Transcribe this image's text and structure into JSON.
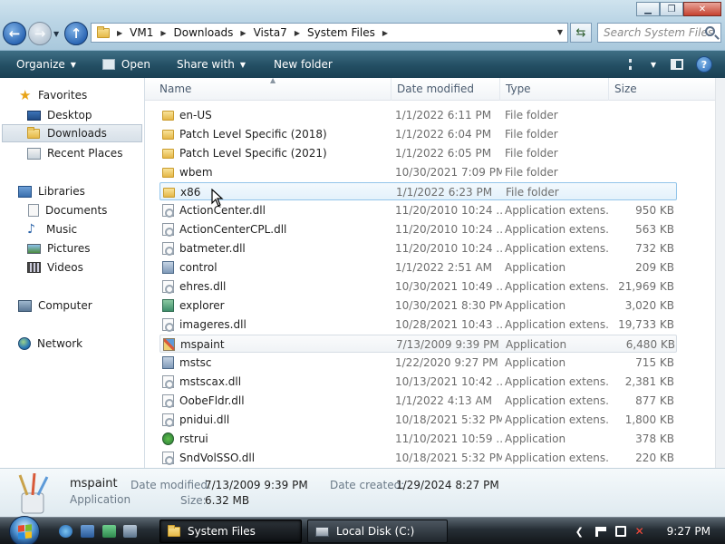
{
  "window": {
    "address": [
      "VM1",
      "Downloads",
      "Vista7",
      "System Files"
    ],
    "search_placeholder": "Search System Files"
  },
  "toolbar": {
    "organize": "Organize",
    "open": "Open",
    "share_with": "Share with",
    "new_folder": "New folder"
  },
  "sidebar": {
    "favorites": "Favorites",
    "desktop": "Desktop",
    "downloads": "Downloads",
    "recent": "Recent Places",
    "libraries": "Libraries",
    "documents": "Documents",
    "music": "Music",
    "pictures": "Pictures",
    "videos": "Videos",
    "computer": "Computer",
    "network": "Network"
  },
  "columns": {
    "name": "Name",
    "date": "Date modified",
    "type": "Type",
    "size": "Size"
  },
  "files": [
    {
      "name": "en-US",
      "date": "1/1/2022 6:11 PM",
      "type": "File folder",
      "size": "",
      "icon": "folder"
    },
    {
      "name": "Patch Level Specific (2018)",
      "date": "1/1/2022 6:04 PM",
      "type": "File folder",
      "size": "",
      "icon": "folder"
    },
    {
      "name": "Patch Level Specific (2021)",
      "date": "1/1/2022 6:05 PM",
      "type": "File folder",
      "size": "",
      "icon": "folder"
    },
    {
      "name": "wbem",
      "date": "10/30/2021 7:09 PM",
      "type": "File folder",
      "size": "",
      "icon": "folder"
    },
    {
      "name": "x86",
      "date": "1/1/2022 6:23 PM",
      "type": "File folder",
      "size": "",
      "icon": "folder"
    },
    {
      "name": "ActionCenter.dll",
      "date": "11/20/2010 10:24 ...",
      "type": "Application extens...",
      "size": "950 KB",
      "icon": "dll"
    },
    {
      "name": "ActionCenterCPL.dll",
      "date": "11/20/2010 10:24 ...",
      "type": "Application extens...",
      "size": "563 KB",
      "icon": "dll"
    },
    {
      "name": "batmeter.dll",
      "date": "11/20/2010 10:24 ...",
      "type": "Application extens...",
      "size": "732 KB",
      "icon": "dll"
    },
    {
      "name": "control",
      "date": "1/1/2022 2:51 AM",
      "type": "Application",
      "size": "209 KB",
      "icon": "app"
    },
    {
      "name": "ehres.dll",
      "date": "10/30/2021 10:49 ...",
      "type": "Application extens...",
      "size": "21,969 KB",
      "icon": "dll"
    },
    {
      "name": "explorer",
      "date": "10/30/2021 8:30 PM",
      "type": "Application",
      "size": "3,020 KB",
      "icon": "app-green"
    },
    {
      "name": "imageres.dll",
      "date": "10/28/2021 10:43 ...",
      "type": "Application extens...",
      "size": "19,733 KB",
      "icon": "dll"
    },
    {
      "name": "mspaint",
      "date": "7/13/2009 9:39 PM",
      "type": "Application",
      "size": "6,480 KB",
      "icon": "paint"
    },
    {
      "name": "mstsc",
      "date": "1/22/2020 9:27 PM",
      "type": "Application",
      "size": "715 KB",
      "icon": "app"
    },
    {
      "name": "mstscax.dll",
      "date": "10/13/2021 10:42 ...",
      "type": "Application extens...",
      "size": "2,381 KB",
      "icon": "dll"
    },
    {
      "name": "OobeFldr.dll",
      "date": "1/1/2022 4:13 AM",
      "type": "Application extens...",
      "size": "877 KB",
      "icon": "dll"
    },
    {
      "name": "pnidui.dll",
      "date": "10/18/2021 5:32 PM",
      "type": "Application extens...",
      "size": "1,800 KB",
      "icon": "dll"
    },
    {
      "name": "rstrui",
      "date": "11/10/2021 10:59 ...",
      "type": "Application",
      "size": "378 KB",
      "icon": "restore"
    },
    {
      "name": "SndVolSSO.dll",
      "date": "10/18/2021 5:32 PM",
      "type": "Application extens...",
      "size": "220 KB",
      "icon": "dll"
    }
  ],
  "details": {
    "name": "mspaint",
    "type": "Application",
    "date_modified_label": "Date modified:",
    "date_modified": "7/13/2009 9:39 PM",
    "date_created_label": "Date created:",
    "date_created": "1/29/2024 8:27 PM",
    "size_label": "Size:",
    "size": "6.32 MB"
  },
  "taskbar": {
    "task1": "System Files",
    "task2": "Local Disk (C:)",
    "clock": "9:27 PM"
  }
}
